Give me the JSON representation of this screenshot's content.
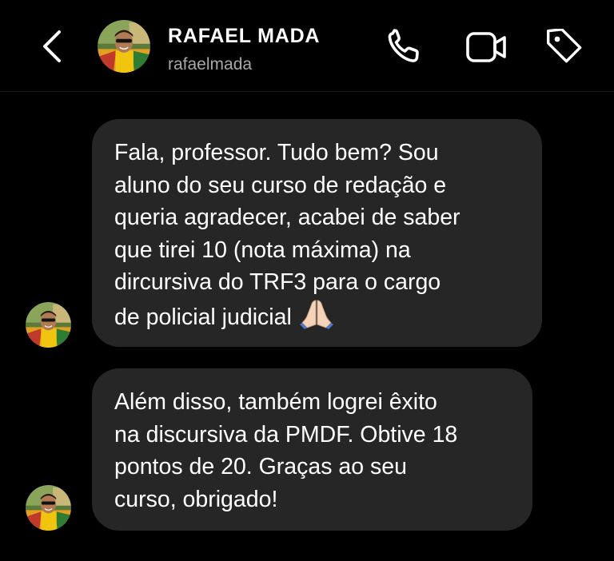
{
  "header": {
    "contact_name": "RAFAEL MADA",
    "contact_handle": "rafaelmada",
    "back_icon": "chevron-left-icon",
    "call_icon": "phone-icon",
    "video_icon": "video-camera-icon",
    "tag_icon": "tag-icon"
  },
  "messages": [
    {
      "lines": [
        "Fala, professor. Tudo bem? Sou",
        "aluno do seu curso de redação e",
        "queria agradecer, acabei de saber",
        "que tirei 10 (nota máxima) na",
        "dircursiva do TRF3 para o cargo",
        "de policial judicial"
      ],
      "emoji": "folded-hands-icon"
    },
    {
      "lines": [
        "Além disso, também logrei êxito",
        "na discursiva da PMDF. Obtive 18",
        "pontos de 20. Graças ao seu",
        "curso, obrigado!"
      ]
    }
  ],
  "colors": {
    "background": "#000000",
    "bubble": "#262626",
    "text": "#ffffff",
    "secondary_text": "#a8a8a8"
  }
}
